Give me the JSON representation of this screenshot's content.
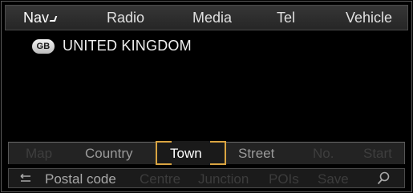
{
  "topbar": {
    "tabs": [
      {
        "label": "Nav",
        "selected": true
      },
      {
        "label": "Radio"
      },
      {
        "label": "Media"
      },
      {
        "label": "Tel"
      },
      {
        "label": "Vehicle"
      }
    ]
  },
  "destination": {
    "country_code": "GB",
    "country_name": "UNITED KINGDOM"
  },
  "address_fields": [
    {
      "label": "Map",
      "state": "disabled"
    },
    {
      "label": "Country",
      "state": "enabled"
    },
    {
      "label": "Town",
      "state": "selected"
    },
    {
      "label": "Street",
      "state": "enabled"
    },
    {
      "label": "No.",
      "state": "disabled"
    },
    {
      "label": "Start",
      "state": "disabled"
    }
  ],
  "actions": {
    "back_icon": "back-arrow-icon",
    "items": [
      {
        "label": "Postal code",
        "state": "enabled"
      },
      {
        "label": "Centre",
        "state": "disabled"
      },
      {
        "label": "Junction",
        "state": "disabled"
      },
      {
        "label": "POIs",
        "state": "disabled"
      },
      {
        "label": "Save",
        "state": "disabled"
      }
    ],
    "search_icon": "search-icon"
  },
  "colors": {
    "selection_highlight": "#d9a441",
    "background": "#000000",
    "bar_background": "#232323"
  }
}
